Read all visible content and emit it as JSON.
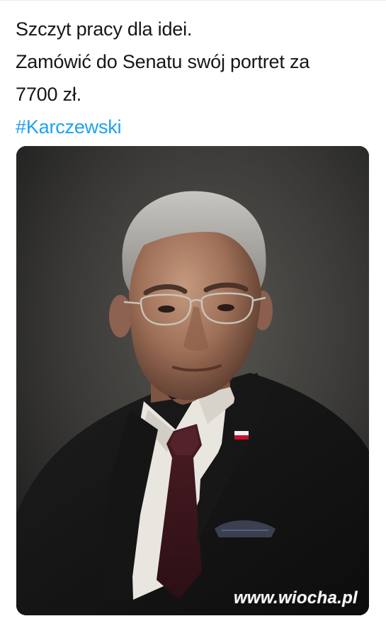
{
  "tweet": {
    "lines": [
      "Szczyt pracy dla idei.",
      "Zamówić do Senatu swój portret za",
      "7700 zł."
    ],
    "hashtag": "#Karczewski"
  },
  "image": {
    "description_icon": "portrait-painting"
  },
  "watermark": {
    "text": "www.wiocha.pl"
  },
  "colors": {
    "text": "#14171a",
    "hashtag": "#1da1f2",
    "background": "#ffffff"
  }
}
